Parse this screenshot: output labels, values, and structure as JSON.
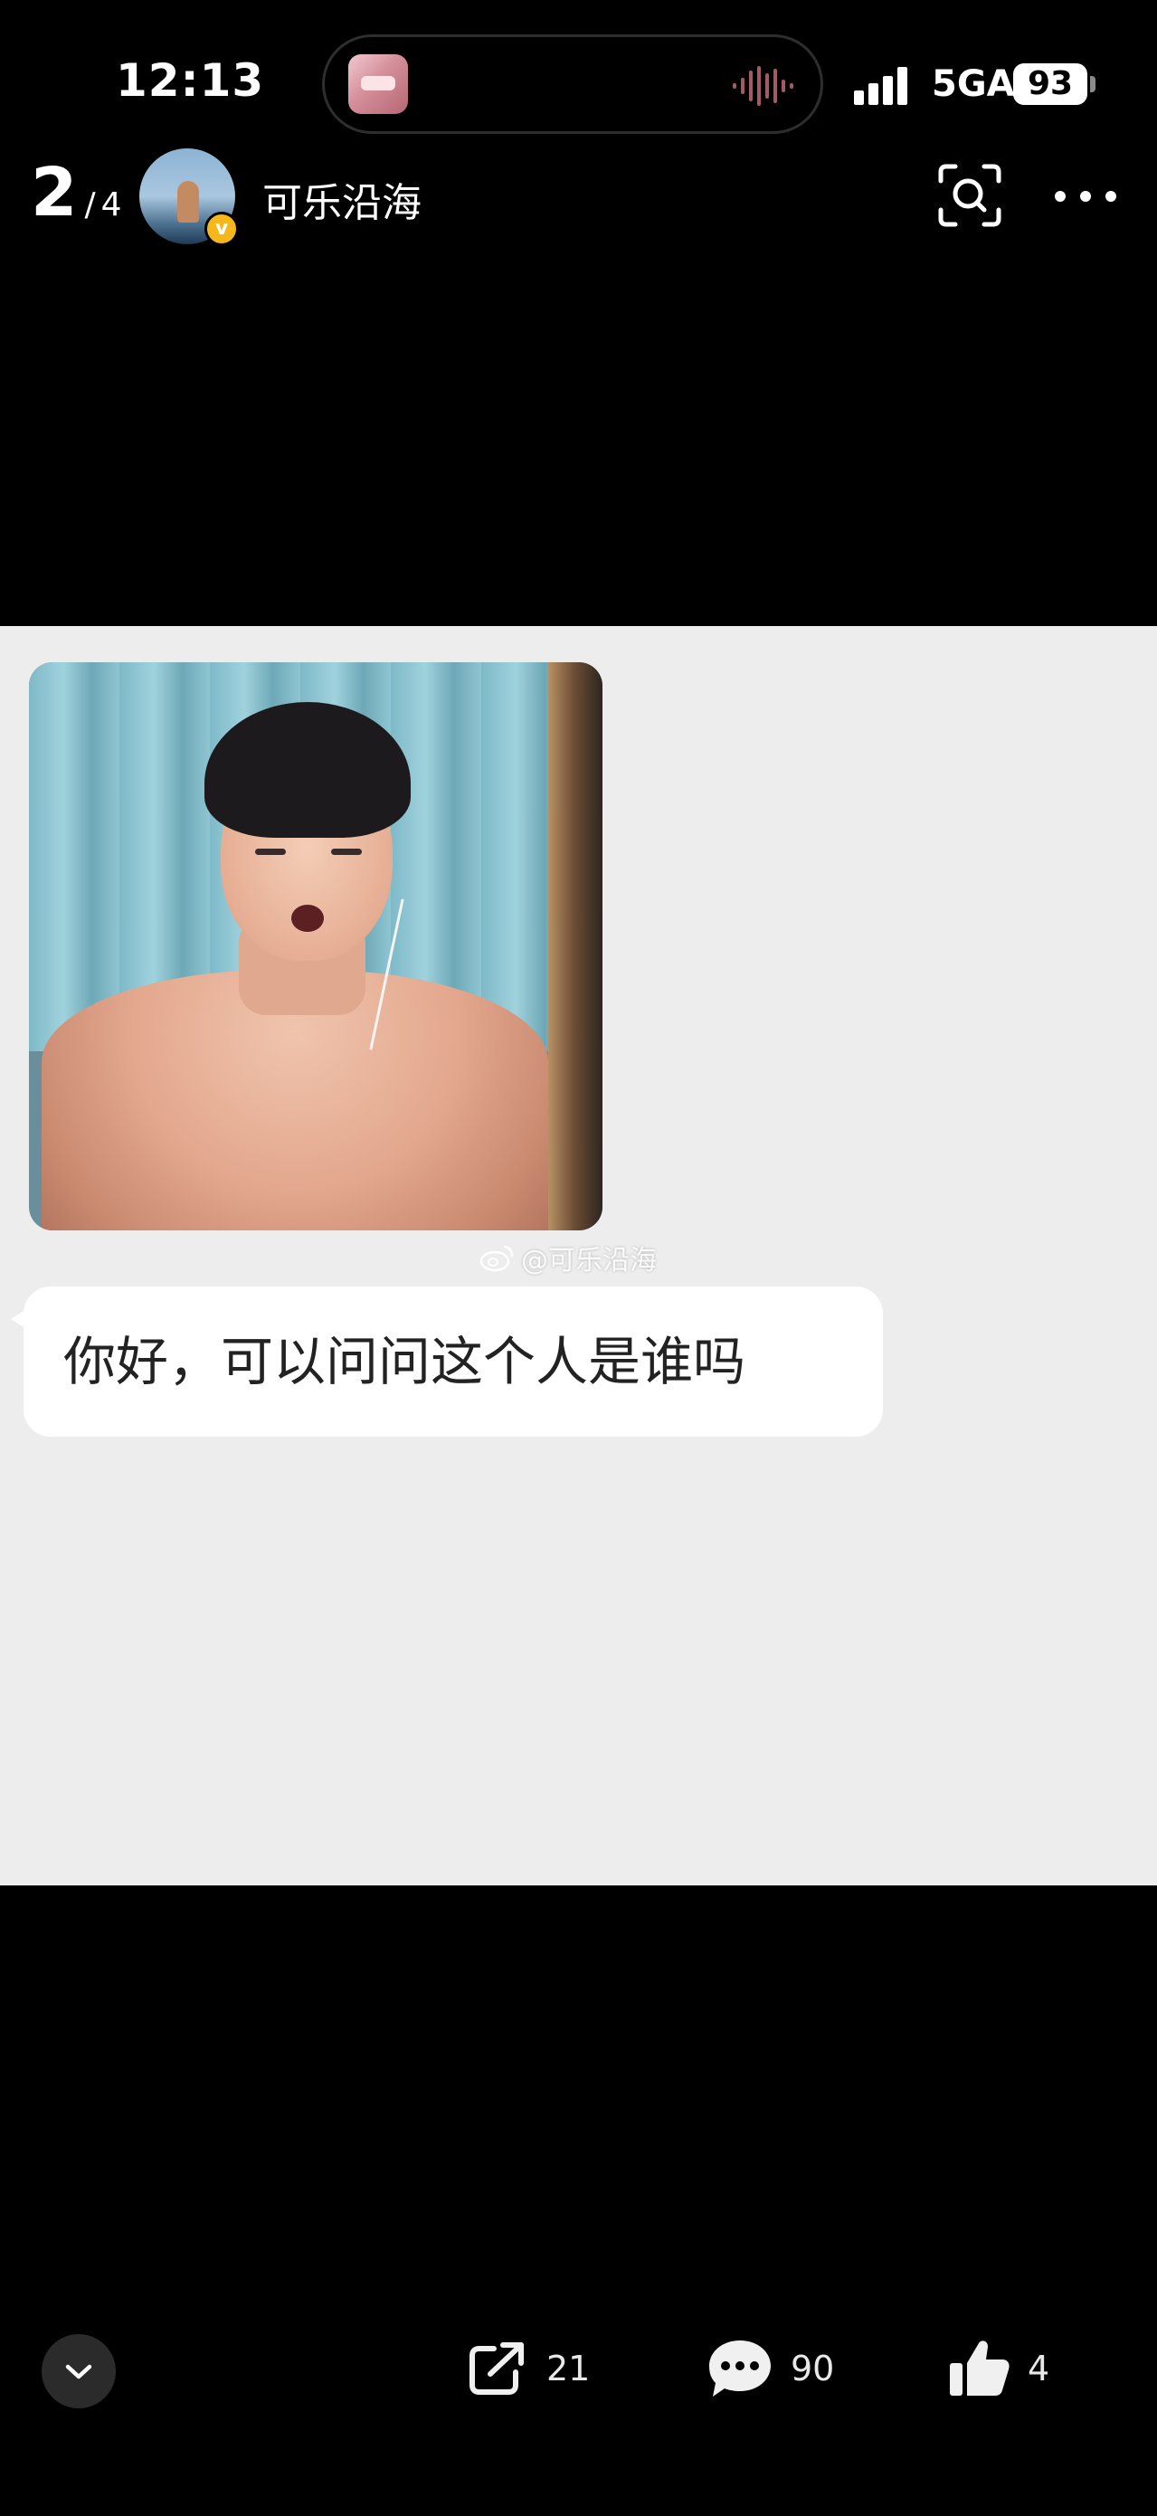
{
  "status_bar": {
    "time": "12:13",
    "network": "5GA",
    "battery": "93"
  },
  "header": {
    "page_current": "2",
    "page_separator": "/",
    "page_total": "4",
    "username": "可乐沿海",
    "verified_mark": "v",
    "icons": [
      "scan-icon",
      "more-icon"
    ]
  },
  "post": {
    "watermark": "@可乐沿海",
    "message": "你好，可以问问这个人是谁吗"
  },
  "actions": {
    "share_count": "21",
    "comment_count": "90",
    "like_count": "4",
    "icons": [
      "chevron-down-icon",
      "share-icon",
      "comment-icon",
      "like-icon"
    ]
  },
  "colors": {
    "background": "#000000",
    "chat_background": "#ededed",
    "bubble": "#ffffff",
    "verified": "#f6b71b"
  }
}
